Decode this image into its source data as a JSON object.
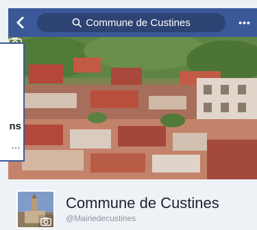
{
  "header": {
    "search_query": "Commune de Custines",
    "back_icon": "chevron-left-icon",
    "search_icon": "search-icon",
    "more_icon": "more-horizontal-icon",
    "bar_color": "#3b5998"
  },
  "left_panel": {
    "title_fragment": "ns",
    "more_label": "…"
  },
  "cover": {
    "camera_icon": "camera-icon"
  },
  "page": {
    "name": "Commune de Custines",
    "handle": "@Mairiedecustines",
    "avatar_camera_icon": "camera-icon"
  }
}
